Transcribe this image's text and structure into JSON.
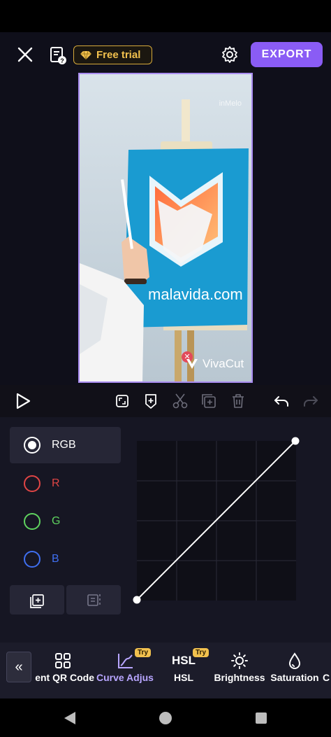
{
  "header": {
    "trial_label": "Free trial",
    "export_label": "EXPORT"
  },
  "preview": {
    "watermark_top": "inMelo",
    "watermark_brand": "VivaCut",
    "sign_text": "malavida.com"
  },
  "channels": [
    {
      "label": "RGB",
      "color": "#ffffff",
      "selected": true
    },
    {
      "label": "R",
      "color": "#e04545",
      "selected": false
    },
    {
      "label": "G",
      "color": "#5fd35f",
      "selected": false
    },
    {
      "label": "B",
      "color": "#3f6ff0",
      "selected": false
    }
  ],
  "tabs": [
    {
      "label": "ent QR Code",
      "icon": "qr-code-icon",
      "try": false
    },
    {
      "label": "Curve Adjus",
      "icon": "curve-icon",
      "try": true,
      "active": true
    },
    {
      "label": "HSL",
      "icon": "hsl-icon",
      "try": true
    },
    {
      "label": "Brightness",
      "icon": "brightness-icon",
      "try": false
    },
    {
      "label": "Saturation",
      "icon": "saturation-icon",
      "try": false
    },
    {
      "label": "C",
      "icon": "partial-icon",
      "try": false
    }
  ],
  "try_label": "Try",
  "colors": {
    "accent": "#8a5cf5",
    "trial_gold": "#f2c14e",
    "active_tab": "#b8a6ff"
  }
}
